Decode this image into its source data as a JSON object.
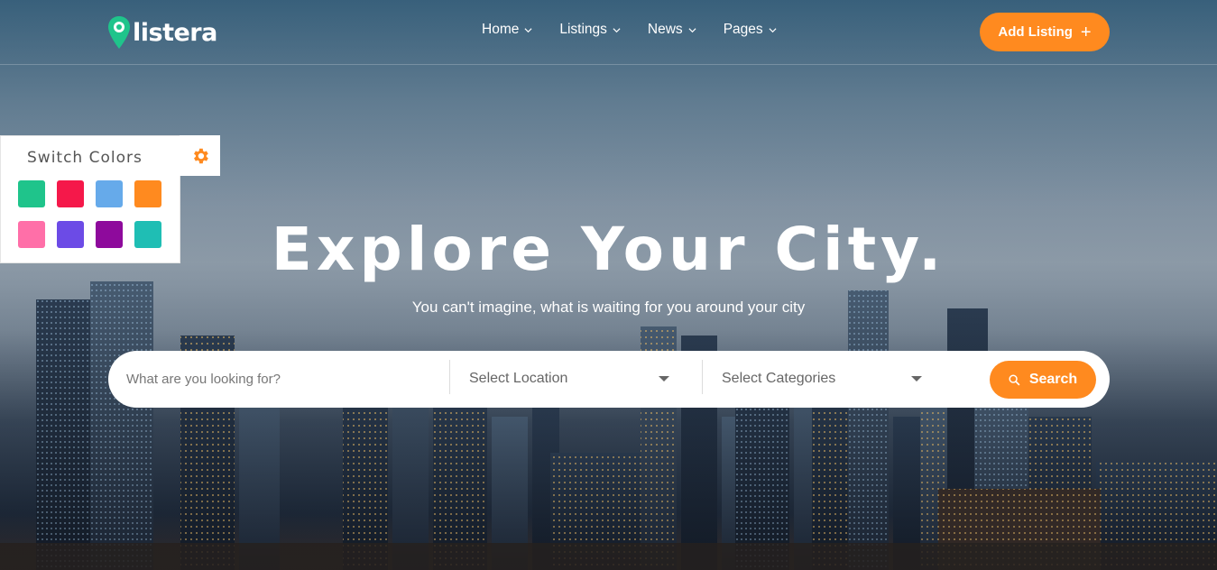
{
  "brand": {
    "name": "listera",
    "accent_color": "#ff8a1f",
    "logo_pin_color": "#1fc48b"
  },
  "nav": {
    "items": [
      {
        "label": "Home",
        "icon": "chevron-down-icon"
      },
      {
        "label": "Listings",
        "icon": "chevron-down-icon"
      },
      {
        "label": "News",
        "icon": "chevron-down-icon"
      },
      {
        "label": "Pages",
        "icon": "chevron-down-icon"
      }
    ],
    "add_listing_label": "Add Listing",
    "add_listing_icon": "plus-icon"
  },
  "color_switcher": {
    "title": "Switch Colors",
    "toggle_icon": "gear-icon",
    "swatches": [
      "#1fc48b",
      "#f5184a",
      "#66aaea",
      "#ff8a1f",
      "#ff6fa8",
      "#6c4be6",
      "#8e0a9c",
      "#1fbeb4"
    ]
  },
  "hero": {
    "title": "Explore Your City.",
    "subtitle": "You can't imagine, what is waiting for you around your city"
  },
  "search": {
    "keyword_placeholder": "What are you looking for?",
    "location_label": "Select Location",
    "categories_label": "Select Categories",
    "button_label": "Search",
    "button_icon": "search-icon"
  }
}
